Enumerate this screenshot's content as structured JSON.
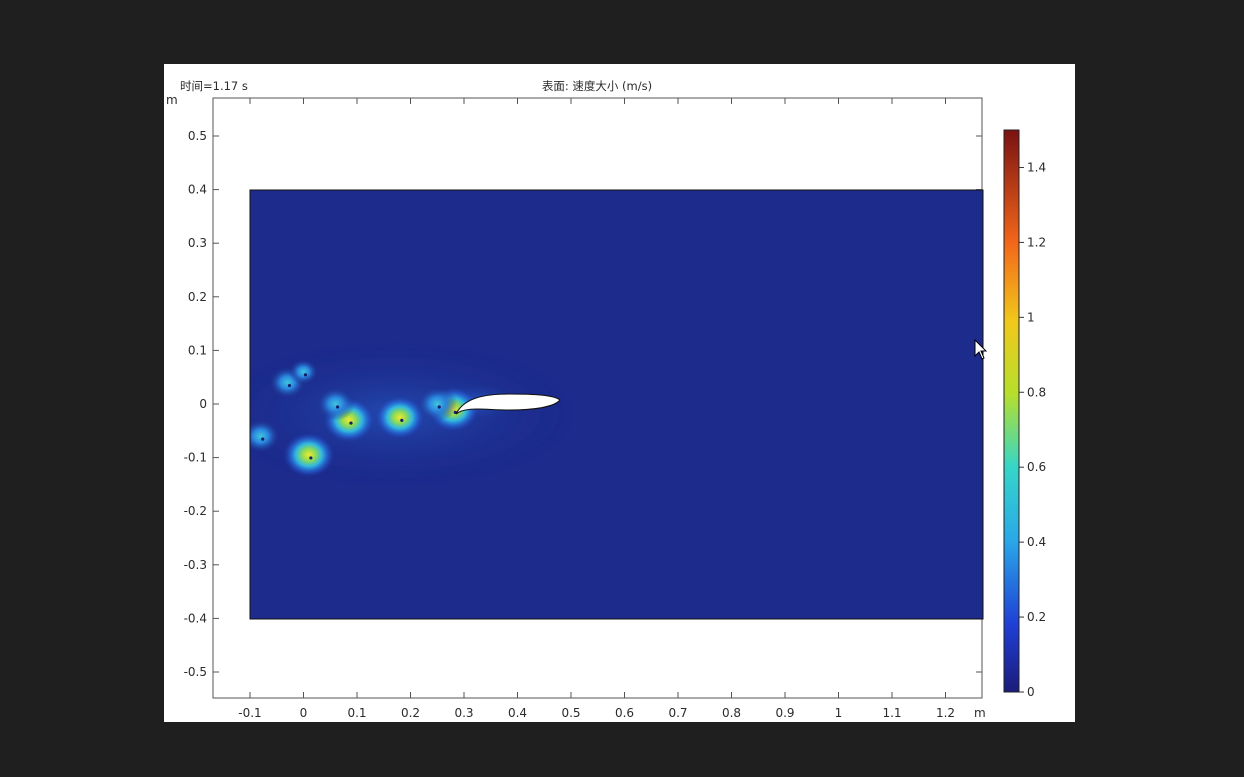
{
  "plot": {
    "time_label": "时间=1.17 s",
    "title": "表面: 速度大小 (m/s)",
    "x_unit": "m",
    "y_unit": "m"
  },
  "colors": {
    "background": "#1f1f1f",
    "field_low": "#1c2b8c",
    "field_high": "#fbe72b",
    "airfoil": "#ffffff"
  },
  "chart_data": {
    "type": "heatmap",
    "title": "表面: 速度大小 (m/s)",
    "xlabel": "m",
    "ylabel": "m",
    "xlim": [
      -0.17,
      1.27
    ],
    "ylim": [
      -0.55,
      0.57
    ],
    "x_ticks": [
      "-0.1",
      "0",
      "0.1",
      "0.2",
      "0.3",
      "0.4",
      "0.5",
      "0.6",
      "0.7",
      "0.8",
      "0.9",
      "1",
      "1.1",
      "1.2"
    ],
    "x_tick_values": [
      -0.1,
      0,
      0.1,
      0.2,
      0.3,
      0.4,
      0.5,
      0.6,
      0.7,
      0.8,
      0.9,
      1,
      1.1,
      1.2
    ],
    "y_ticks": [
      "0.5",
      "0.4",
      "0.3",
      "0.2",
      "0.1",
      "0",
      "-0.1",
      "-0.2",
      "-0.3",
      "-0.4",
      "-0.5"
    ],
    "y_tick_values": [
      0.5,
      0.4,
      0.3,
      0.2,
      0.1,
      0,
      -0.1,
      -0.2,
      -0.3,
      -0.4,
      -0.5
    ],
    "domain": {
      "x": [
        -0.1,
        1.27
      ],
      "y": [
        -0.4,
        0.4
      ]
    },
    "colorbar": {
      "range": [
        0,
        1.5
      ],
      "ticks": [
        "1.4",
        "1.2",
        "1",
        "0.8",
        "0.6",
        "0.4",
        "0.2",
        "0"
      ],
      "tick_values": [
        1.4,
        1.2,
        1.0,
        0.8,
        0.6,
        0.4,
        0.2,
        0
      ],
      "colormap": "rainbow"
    },
    "vortices": [
      {
        "x": 0.28,
        "y": -0.01,
        "speed": 0.95
      },
      {
        "x": 0.25,
        "y": 0.0,
        "speed": 0.6
      },
      {
        "x": 0.18,
        "y": -0.025,
        "speed": 0.9
      },
      {
        "x": 0.085,
        "y": -0.03,
        "speed": 0.95
      },
      {
        "x": 0.06,
        "y": 0.0,
        "speed": 0.55
      },
      {
        "x": 0.01,
        "y": -0.095,
        "speed": 0.95
      },
      {
        "x": -0.03,
        "y": 0.04,
        "speed": 0.5
      },
      {
        "x": -0.08,
        "y": -0.06,
        "speed": 0.55
      },
      {
        "x": 0.0,
        "y": 0.06,
        "speed": 0.3
      }
    ]
  }
}
